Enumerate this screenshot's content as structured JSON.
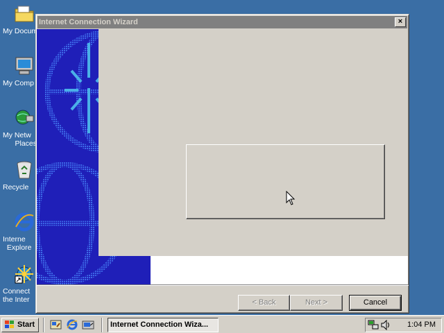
{
  "desktop": {
    "icons": [
      {
        "label": "My Docum",
        "icon": "folder-icon"
      },
      {
        "label": "My Comp",
        "icon": "computer-icon"
      },
      {
        "label": "My Netw\n      Places",
        "icon": "network-icon"
      },
      {
        "label": "Recycle",
        "icon": "recycle-bin-icon"
      },
      {
        "label": "Interne\n  Explore",
        "icon": "internet-explorer-icon"
      },
      {
        "label": "Connect\nthe Inter",
        "icon": "connect-internet-icon"
      }
    ]
  },
  "window": {
    "title": "Internet Connection Wizard",
    "close_label": "×",
    "buttons": {
      "back": "< Back",
      "next": "Next >",
      "cancel": "Cancel"
    }
  },
  "taskbar": {
    "start_label": "Start",
    "task_label": "Internet Connection Wiza...",
    "clock": "1:04 PM"
  },
  "colors": {
    "desktop": "#3a6ea5",
    "side_panel": "#2020c0",
    "title_inactive": "#808080",
    "face": "#d4d0c8"
  }
}
